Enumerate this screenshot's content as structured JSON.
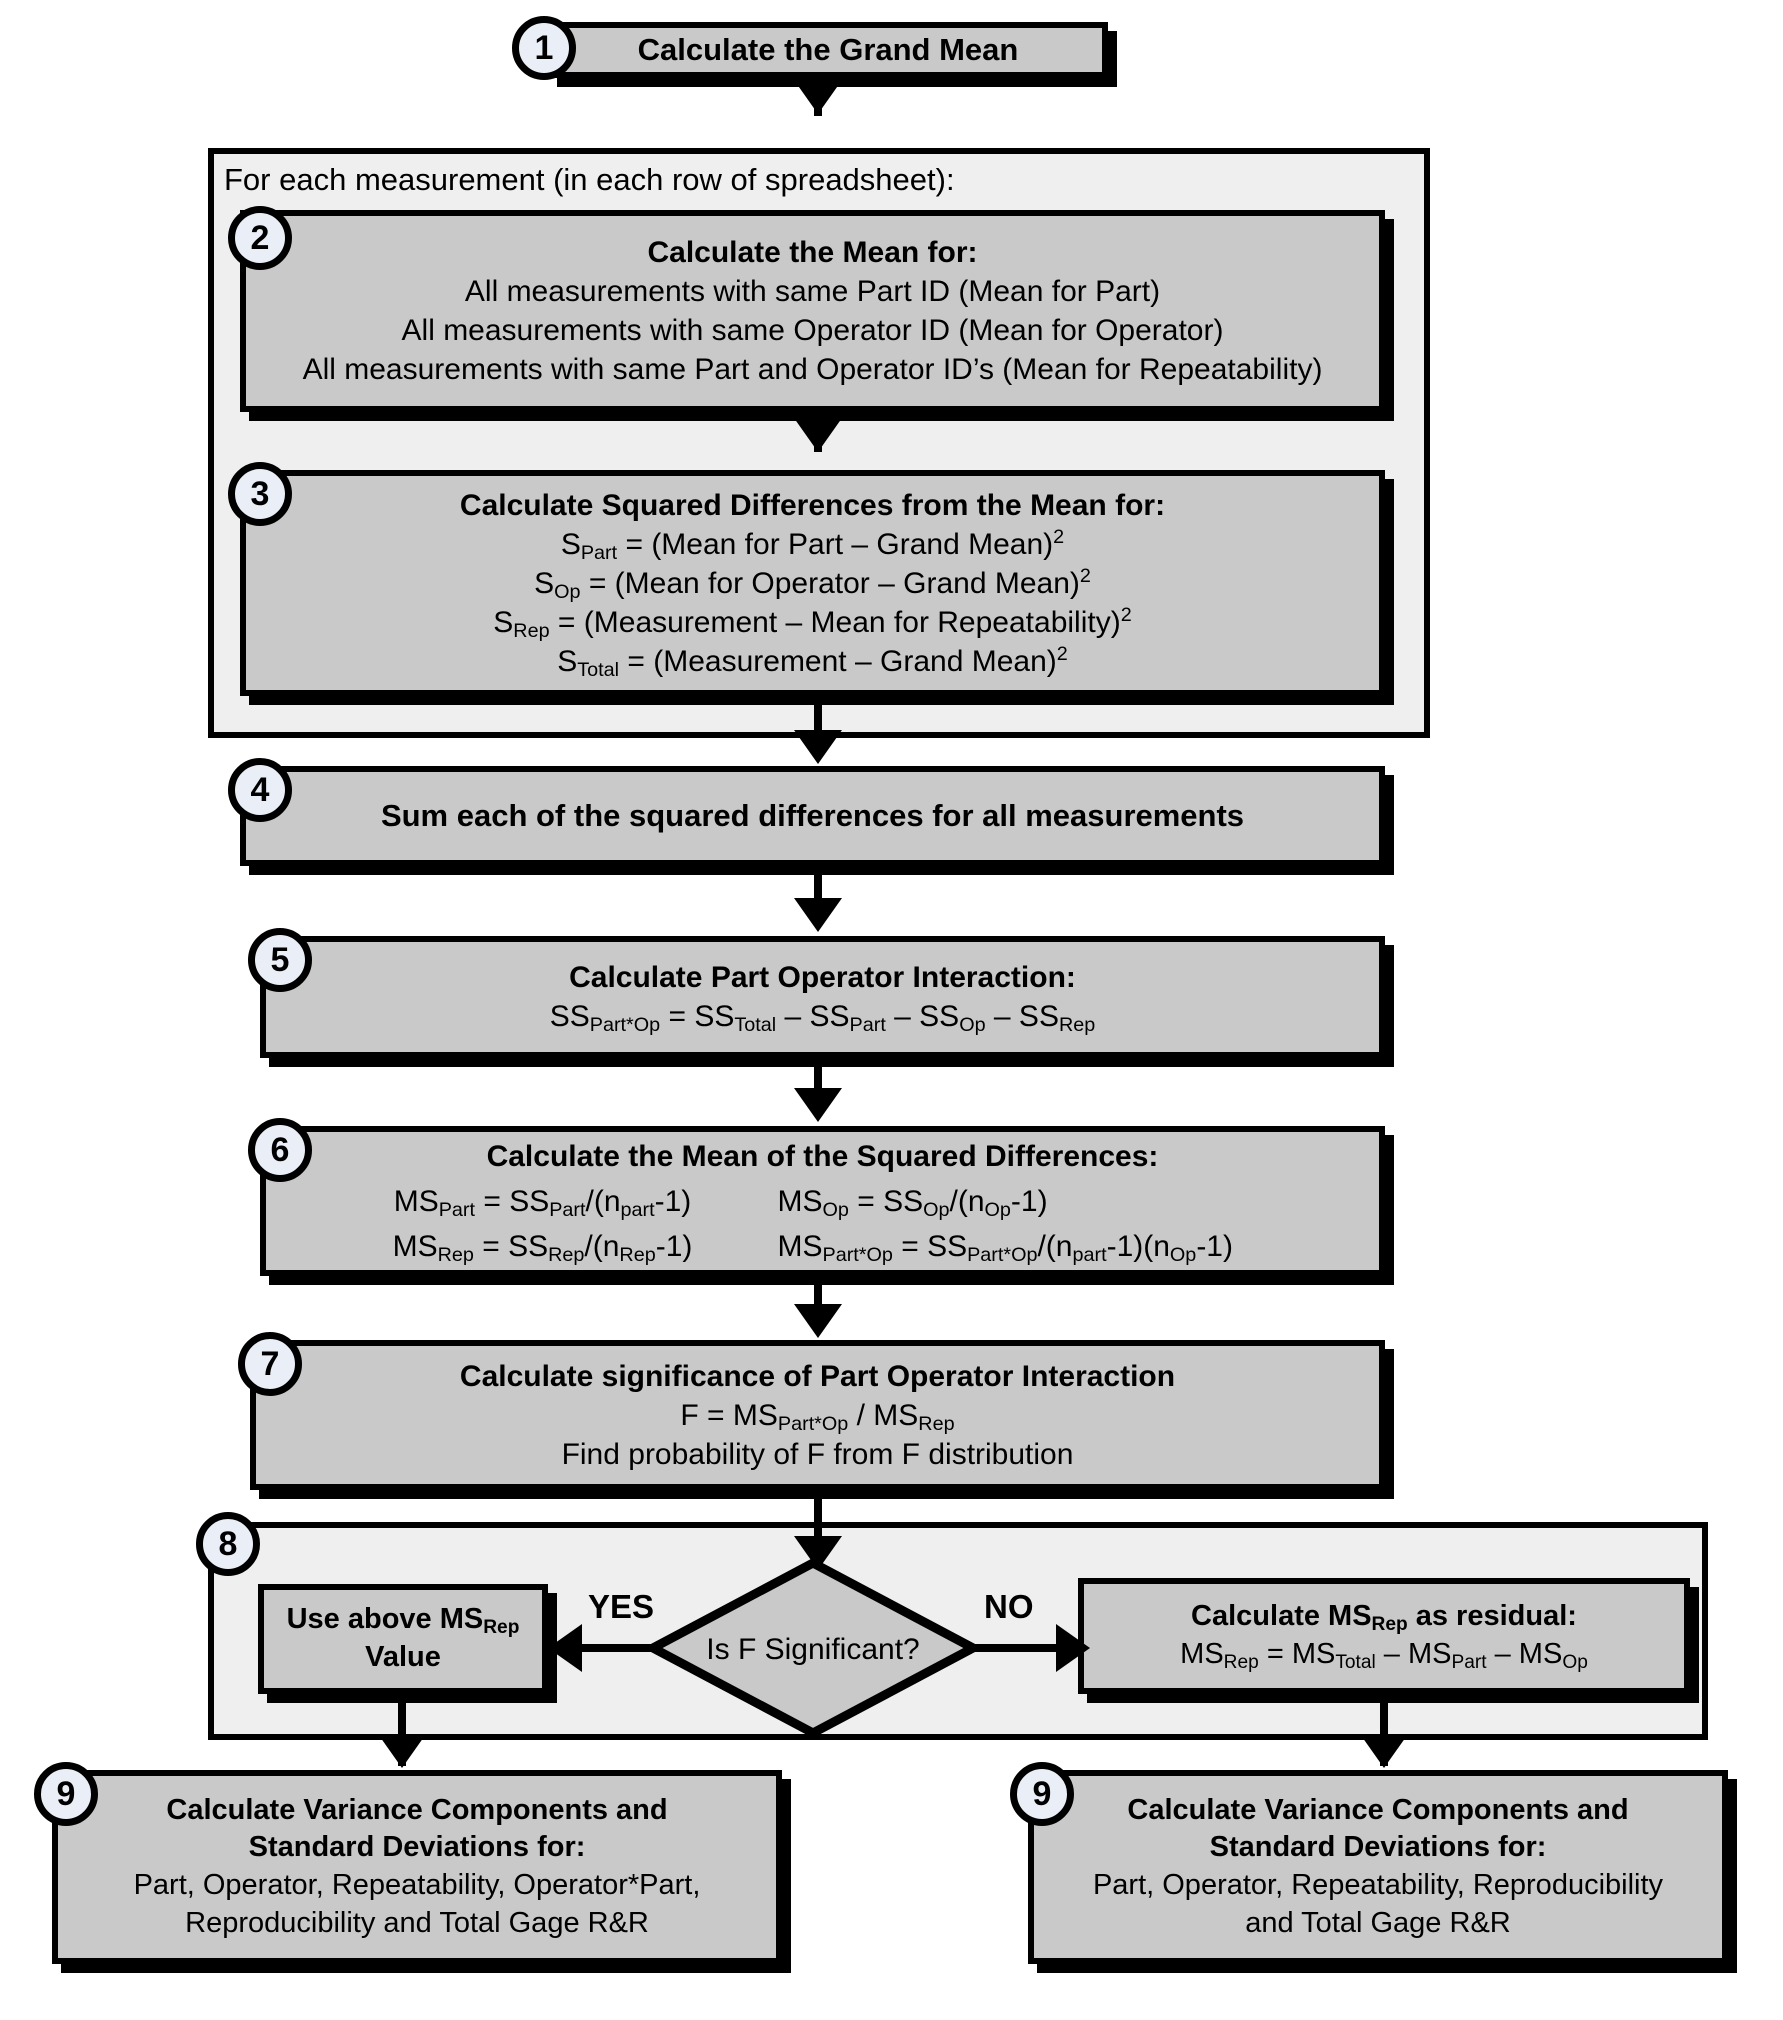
{
  "diagram": {
    "title": "Gage R&R ANOVA Calculation Flowchart",
    "colors": {
      "box_fill": "#c9c9c9",
      "group_fill": "#efefef",
      "badge_fill": "#e9eef7",
      "stroke": "#000000"
    }
  },
  "step1": {
    "badge": "1",
    "header": "Calculate the Grand Mean"
  },
  "group_loop": {
    "label": "For each measurement (in each row of spreadsheet):"
  },
  "step2": {
    "badge": "2",
    "header": "Calculate the Mean for:",
    "lines": [
      "All measurements with same Part ID (Mean for Part)",
      "All measurements with same Operator ID (Mean for Operator)",
      "All measurements with same Part and Operator ID’s (Mean for Repeatability)"
    ]
  },
  "step3": {
    "badge": "3",
    "header": "Calculate Squared Differences from the Mean for:",
    "formulas": [
      {
        "lhs": "S",
        "lhs_sub": "Part",
        "rhs": " = (Mean for Part – Grand Mean)",
        "sup": "2"
      },
      {
        "lhs": "S",
        "lhs_sub": "Op",
        "rhs": " = (Mean for Operator – Grand Mean)",
        "sup": "2"
      },
      {
        "lhs": "S",
        "lhs_sub": "Rep",
        "rhs": " = (Measurement – Mean for Repeatability)",
        "sup": "2"
      },
      {
        "lhs": "S",
        "lhs_sub": "Total",
        "rhs": " = (Measurement  – Grand Mean)",
        "sup": "2"
      }
    ]
  },
  "step4": {
    "badge": "4",
    "header": "Sum each of the squared differences for all measurements"
  },
  "step5": {
    "badge": "5",
    "header": "Calculate Part Operator Interaction:",
    "formula": {
      "parts": [
        {
          "t": "SS",
          "sub": "Part*Op"
        },
        {
          "t": " = SS",
          "sub": "Total"
        },
        {
          "t": " – SS",
          "sub": "Part"
        },
        {
          "t": " – SS",
          "sub": "Op"
        },
        {
          "t": " – SS",
          "sub": "Rep"
        }
      ]
    }
  },
  "step6": {
    "badge": "6",
    "header": "Calculate the Mean of the Squared Differences:",
    "cells": [
      {
        "parts": [
          {
            "t": "MS",
            "sub": "Part"
          },
          {
            "t": " = SS",
            "sub": "Part"
          },
          {
            "t": "/(n",
            "sub": "part"
          },
          {
            "t": "-1)",
            "sub": ""
          }
        ]
      },
      {
        "parts": [
          {
            "t": "MS",
            "sub": "Op"
          },
          {
            "t": " = SS",
            "sub": "Op"
          },
          {
            "t": "/(n",
            "sub": "Op"
          },
          {
            "t": "-1)",
            "sub": ""
          }
        ]
      },
      {
        "parts": [
          {
            "t": "MS",
            "sub": "Rep"
          },
          {
            "t": " = SS",
            "sub": "Rep"
          },
          {
            "t": "/(n",
            "sub": "Rep"
          },
          {
            "t": "-1)",
            "sub": ""
          }
        ]
      },
      {
        "parts": [
          {
            "t": "MS",
            "sub": "Part*Op"
          },
          {
            "t": " = SS",
            "sub": "Part*Op"
          },
          {
            "t": "/(n",
            "sub": "part"
          },
          {
            "t": "-1)(n",
            "sub": "Op"
          },
          {
            "t": "-1)",
            "sub": ""
          }
        ]
      }
    ]
  },
  "step7": {
    "badge": "7",
    "header": "Calculate significance of Part Operator Interaction",
    "formula": {
      "parts": [
        {
          "t": "F = MS",
          "sub": "Part*Op"
        },
        {
          "t": " / MS",
          "sub": "Rep"
        }
      ]
    },
    "note": "Find probability of F from F distribution"
  },
  "step8": {
    "badge": "8",
    "decision": "Is F Significant?",
    "yes_label": "YES",
    "no_label": "NO",
    "yes_box": {
      "line1_parts": [
        {
          "t": "Use above MS",
          "sub": "Rep"
        }
      ],
      "line2": "Value"
    },
    "no_box": {
      "header_parts": [
        {
          "t": "Calculate MS",
          "sub": "Rep"
        },
        {
          "t": " as residual:",
          "sub": ""
        }
      ],
      "formula_parts": [
        {
          "t": "MS",
          "sub": "Rep"
        },
        {
          "t": " = MS",
          "sub": "Total"
        },
        {
          "t": " – MS",
          "sub": "Part"
        },
        {
          "t": " – MS",
          "sub": "Op"
        }
      ]
    }
  },
  "step9_left": {
    "badge": "9",
    "header_line1": "Calculate Variance Components and",
    "header_line2": "Standard Deviations for:",
    "body_line1": "Part, Operator, Repeatability, Operator*Part,",
    "body_line2": "Reproducibility and Total Gage R&R"
  },
  "step9_right": {
    "badge": "9",
    "header_line1": "Calculate Variance Components and",
    "header_line2": "Standard Deviations for:",
    "body_line1": "Part, Operator, Repeatability, Reproducibility",
    "body_line2": "and Total Gage R&R"
  }
}
